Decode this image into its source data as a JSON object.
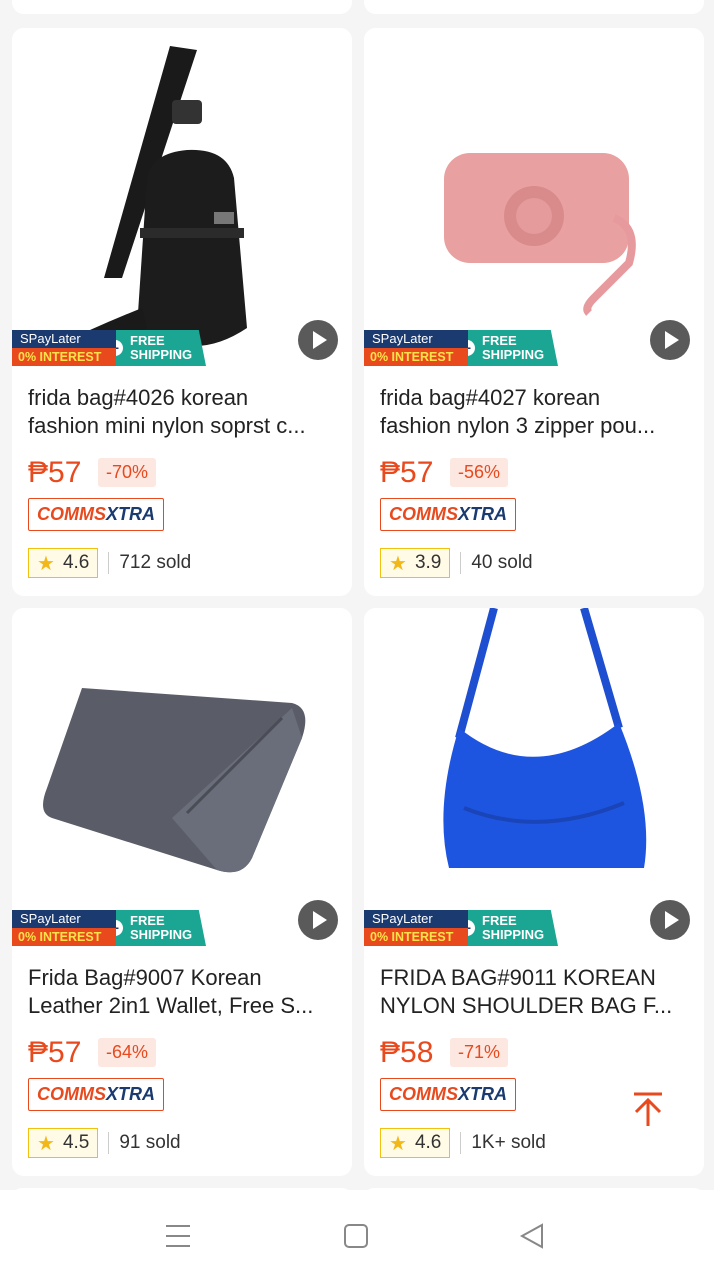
{
  "badges": {
    "spaylater": "SPayLater",
    "interest": "0% INTEREST",
    "free1": "FREE",
    "free2": "SHIPPING"
  },
  "comms": {
    "a": "COMMS",
    "b": "XTRA"
  },
  "products": [
    {
      "title1": "frida bag#4026 korean",
      "title2": "fashion mini nylon soprst c...",
      "price": "₱57",
      "discount": "-70%",
      "rating": "4.6",
      "sold": "712 sold",
      "image": "black sling bag"
    },
    {
      "title1": "frida bag#4027 korean",
      "title2": "fashion nylon 3 zipper pou...",
      "price": "₱57",
      "discount": "-56%",
      "rating": "3.9",
      "sold": "40 sold",
      "image": "pink pouch"
    },
    {
      "title1": "Frida Bag#9007 Korean",
      "title2": "Leather 2in1 Wallet, Free S...",
      "price": "₱57",
      "discount": "-64%",
      "rating": "4.5",
      "sold": "91 sold",
      "image": "grey wallet"
    },
    {
      "title1": "FRIDA BAG#9011 KOREAN",
      "title2": "NYLON SHOULDER BAG F...",
      "price": "₱58",
      "discount": "-71%",
      "rating": "4.6",
      "sold": "1K+ sold",
      "image": "blue shoulder bag"
    }
  ],
  "icons": {
    "menu": "menu-icon",
    "home": "home-icon",
    "back": "back-icon",
    "scroll_top": "arrow-up-icon",
    "play": "play-icon",
    "star": "star-icon"
  }
}
